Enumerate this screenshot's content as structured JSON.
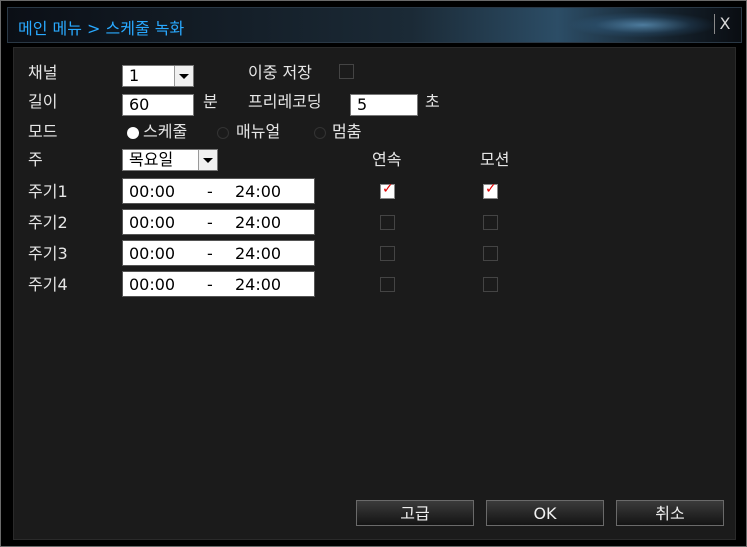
{
  "window": {
    "title": "메인 메뉴 > 스케줄 녹화",
    "close_label": "X"
  },
  "form": {
    "channel_label": "채널",
    "channel_value": "1",
    "redundancy_label": "이중 저장",
    "redundancy_checked": false,
    "length_label": "길이",
    "length_value": "60",
    "length_unit": "분",
    "prerecord_label": "프리레코딩",
    "prerecord_value": "5",
    "prerecord_unit": "초",
    "mode_label": "모드",
    "mode_options": [
      {
        "label": "스케줄",
        "selected": true
      },
      {
        "label": "매뉴얼",
        "selected": false
      },
      {
        "label": "멈춤",
        "selected": false
      }
    ],
    "week_label": "주",
    "week_value": "목요일",
    "col_continuous": "연속",
    "col_motion": "모션",
    "periods": [
      {
        "label": "주기1",
        "start": "00:00",
        "sep": "-",
        "end": "24:00",
        "continuous": true,
        "motion": true
      },
      {
        "label": "주기2",
        "start": "00:00",
        "sep": "-",
        "end": "24:00",
        "continuous": false,
        "motion": false
      },
      {
        "label": "주기3",
        "start": "00:00",
        "sep": "-",
        "end": "24:00",
        "continuous": false,
        "motion": false
      },
      {
        "label": "주기4",
        "start": "00:00",
        "sep": "-",
        "end": "24:00",
        "continuous": false,
        "motion": false
      }
    ]
  },
  "buttons": {
    "advanced": "고급",
    "ok": "OK",
    "cancel": "취소"
  }
}
